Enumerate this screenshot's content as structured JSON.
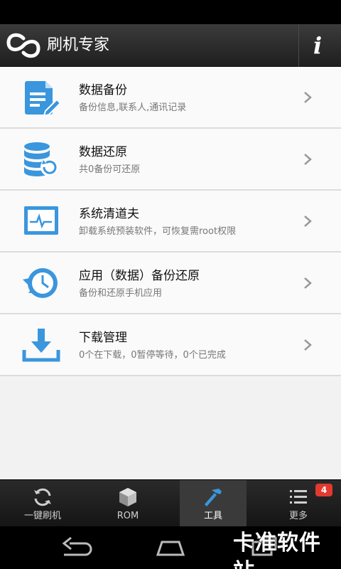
{
  "app": {
    "title": "刷机专家",
    "info_label": "i"
  },
  "colors": {
    "accent": "#3a96dd",
    "badge": "#e23a2f"
  },
  "menu": [
    {
      "title": "数据备份",
      "subtitle": "备份信息,联系人,通讯记录",
      "icon": "document-edit-icon"
    },
    {
      "title": "数据还原",
      "subtitle": "共0备份可还原",
      "icon": "database-restore-icon"
    },
    {
      "title": "系统清道夫",
      "subtitle": "卸载系统预装软件，可恢复需root权限",
      "icon": "monitor-pulse-icon"
    },
    {
      "title": "应用（数据）备份还原",
      "subtitle": "备份和还原手机应用",
      "icon": "clock-restore-icon"
    },
    {
      "title": "下载管理",
      "subtitle": "0个在下载，0暂停等待，0个已完成",
      "icon": "download-tray-icon"
    }
  ],
  "tabs": [
    {
      "label": "一键刷机",
      "icon": "refresh-icon"
    },
    {
      "label": "ROM",
      "icon": "cube-icon"
    },
    {
      "label": "工具",
      "icon": "hammer-icon",
      "active": true
    },
    {
      "label": "更多",
      "icon": "list-icon",
      "badge": "4"
    }
  ],
  "watermark": {
    "text": "卡准软件站"
  }
}
